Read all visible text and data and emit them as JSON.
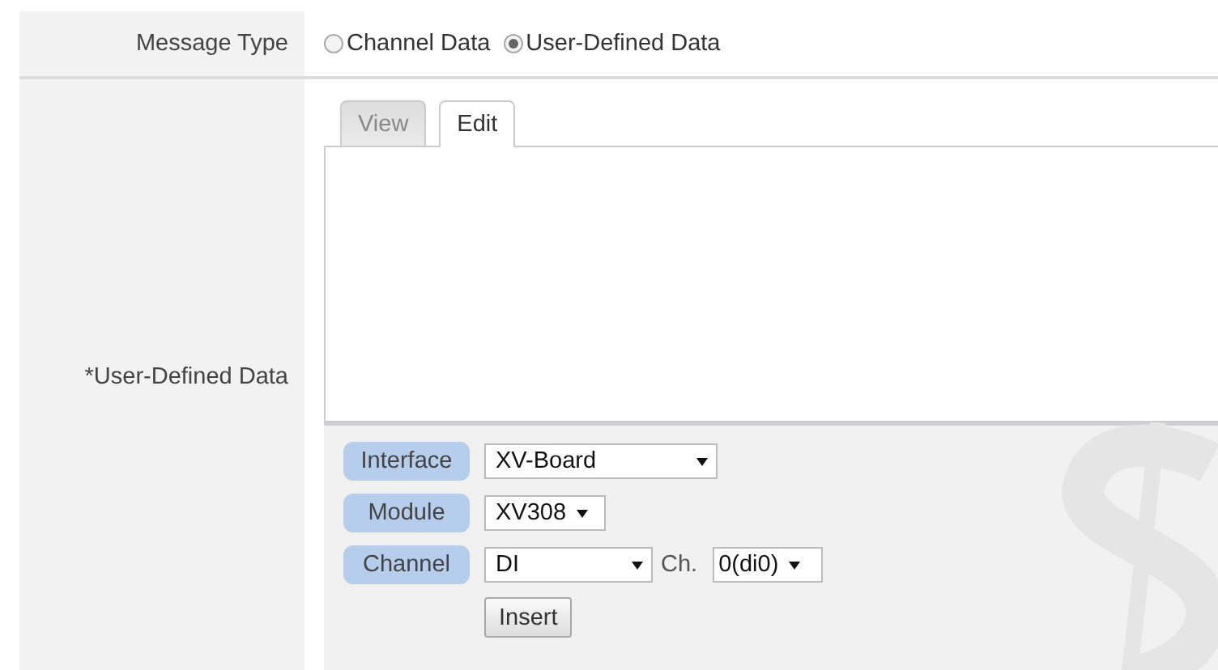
{
  "message_type": {
    "label": "Message Type",
    "options": [
      {
        "label": "Channel Data",
        "selected": false
      },
      {
        "label": "User-Defined Data",
        "selected": true
      }
    ]
  },
  "user_defined_data": {
    "label": "*User-Defined Data",
    "tabs": [
      {
        "label": "View",
        "selected": false
      },
      {
        "label": "Edit",
        "selected": true
      }
    ],
    "fields": [
      {
        "label": "Interface",
        "value": "XV-Board"
      },
      {
        "label": "Module",
        "value": "XV308"
      },
      {
        "label": "Channel",
        "value": "DI",
        "extra_label": "Ch.",
        "extra_value": "0(di0)"
      }
    ],
    "insert_button": "Insert"
  }
}
